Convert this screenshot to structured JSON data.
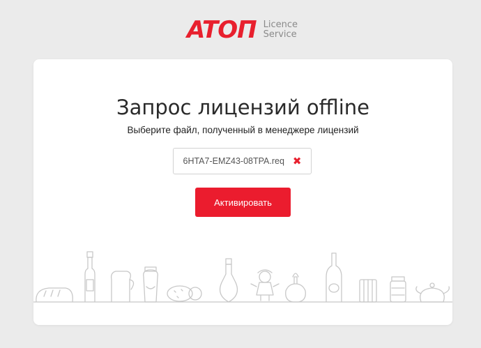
{
  "header": {
    "logo_text": "ATOΠ",
    "logo_sub_line1": "Licence",
    "logo_sub_line2": "Service"
  },
  "card": {
    "title": "Запрос лицензий offline",
    "subtitle": "Выберите файл, полученный в менеджере лицензий",
    "file_name": "6HTA7-EMZ43-08TPA.req",
    "remove_glyph": "✖",
    "activate_label": "Активировать"
  },
  "colors": {
    "accent": "#eb1c2e",
    "background": "#ebebeb",
    "card": "#ffffff",
    "illustration_stroke": "#c8c8c8"
  }
}
